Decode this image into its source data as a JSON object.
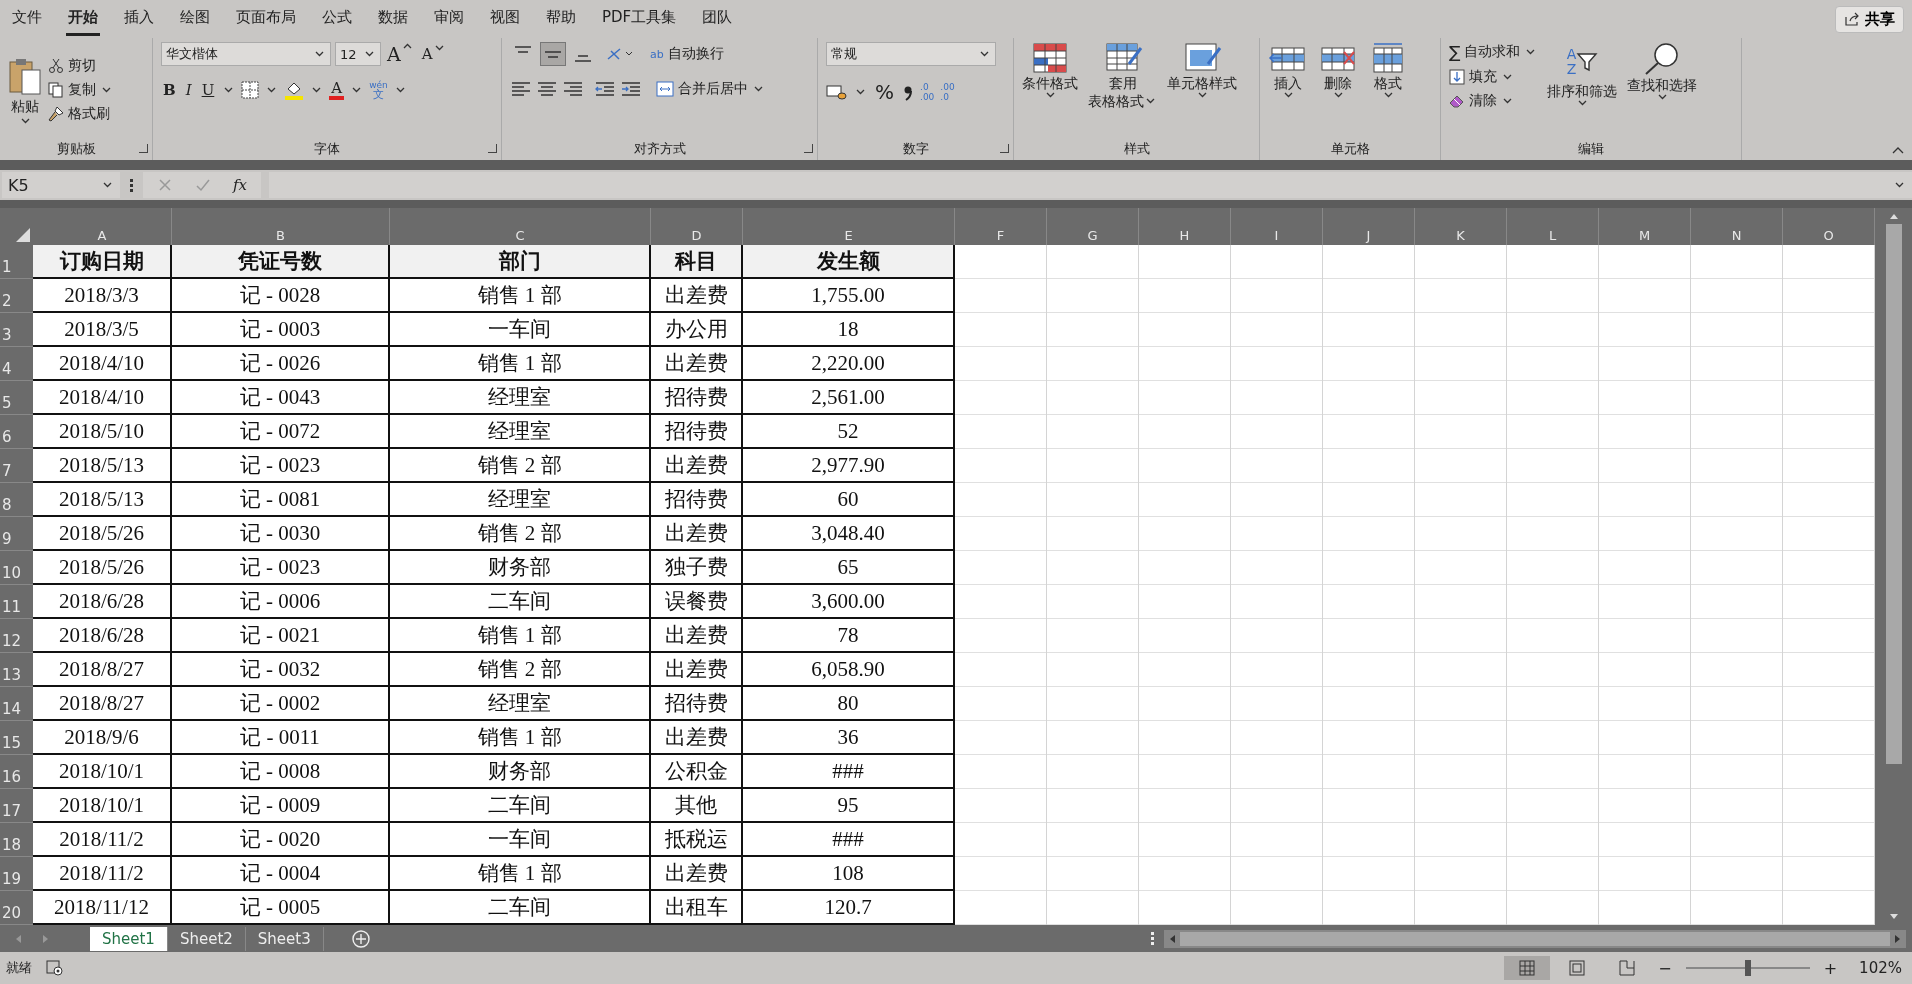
{
  "menu_tabs": [
    {
      "label": "文件",
      "selected": false
    },
    {
      "label": "开始",
      "selected": true
    },
    {
      "label": "插入",
      "selected": false
    },
    {
      "label": "绘图",
      "selected": false
    },
    {
      "label": "页面布局",
      "selected": false
    },
    {
      "label": "公式",
      "selected": false
    },
    {
      "label": "数据",
      "selected": false
    },
    {
      "label": "审阅",
      "selected": false
    },
    {
      "label": "视图",
      "selected": false
    },
    {
      "label": "帮助",
      "selected": false
    },
    {
      "label": "PDF工具集",
      "selected": false
    },
    {
      "label": "团队",
      "selected": false
    }
  ],
  "share_button": "共享",
  "clipboard": {
    "paste": "粘贴",
    "cut": "剪切",
    "copy": "复制",
    "format_painter": "格式刷",
    "label": "剪贴板"
  },
  "font": {
    "font_name": "华文楷体",
    "font_size": "12",
    "grow": "A",
    "shrink": "A",
    "bold": "B",
    "italic": "I",
    "underline": "U",
    "font_color": "A",
    "phonetic_top": "wén",
    "phonetic_bottom": "文",
    "label": "字体"
  },
  "alignment": {
    "vertical": [
      {
        "kind": "top",
        "selected": false
      },
      {
        "kind": "middle",
        "selected": true
      },
      {
        "kind": "bottom",
        "selected": false
      }
    ],
    "wrap_icon": "ab",
    "wrap_text": "自动换行",
    "merge_center": "合并后居中",
    "label": "对齐方式"
  },
  "number": {
    "format": "常规",
    "percent": "%",
    "decimals": [
      {
        "top": ".0",
        "bottom": ".00"
      },
      {
        "top": ".00",
        "bottom": ".0"
      }
    ],
    "label": "数字"
  },
  "styles": {
    "buttons": [
      {
        "kind": "conditional",
        "label": "条件格式"
      },
      {
        "kind": "table",
        "label": "套用",
        "label2": "表格格式"
      },
      {
        "kind": "cell",
        "label": "单元格样式"
      }
    ],
    "label": "样式"
  },
  "cells": {
    "buttons": [
      {
        "kind": "insert",
        "label": "插入"
      },
      {
        "kind": "delete",
        "label": "删除"
      },
      {
        "kind": "format",
        "label": "格式"
      }
    ],
    "label": "单元格"
  },
  "editing": {
    "autosum_icon": "∑",
    "autosum": "自动求和",
    "fill": "填充",
    "clear": "清除",
    "sort_letters": [
      "A",
      "Z"
    ],
    "sort_filter": "排序和筛选",
    "find_select": "查找和选择",
    "label": "编辑"
  },
  "formula_bar": {
    "name_box": "K5",
    "fx": "fx"
  },
  "sheet": {
    "columns": [
      "A",
      "B",
      "C",
      "D",
      "E",
      "F",
      "G",
      "H",
      "I",
      "J",
      "K",
      "L",
      "M",
      "N",
      "O"
    ],
    "row_headers": [
      "1",
      "2",
      "3",
      "4",
      "5",
      "6",
      "7",
      "8",
      "9",
      "10",
      "11",
      "12",
      "13",
      "14",
      "15",
      "16",
      "17",
      "18",
      "19",
      "20"
    ],
    "header": [
      "订购日期",
      "凭证号数",
      "部门",
      "科目",
      "发生额"
    ],
    "rows": [
      [
        "2018/3/3",
        "记 - 0028",
        "销售 1 部",
        "出差费",
        "1,755.00"
      ],
      [
        "2018/3/5",
        "记 - 0003",
        "一车间",
        "办公用",
        "18"
      ],
      [
        "2018/4/10",
        "记 - 0026",
        "销售 1 部",
        "出差费",
        "2,220.00"
      ],
      [
        "2018/4/10",
        "记 - 0043",
        "经理室",
        "招待费",
        "2,561.00"
      ],
      [
        "2018/5/10",
        "记 - 0072",
        "经理室",
        "招待费",
        "52"
      ],
      [
        "2018/5/13",
        "记 - 0023",
        "销售 2 部",
        "出差费",
        "2,977.90"
      ],
      [
        "2018/5/13",
        "记 - 0081",
        "经理室",
        "招待费",
        "60"
      ],
      [
        "2018/5/26",
        "记 - 0030",
        "销售 2 部",
        "出差费",
        "3,048.40"
      ],
      [
        "2018/5/26",
        "记 - 0023",
        "财务部",
        "独子费",
        "65"
      ],
      [
        "2018/6/28",
        "记 - 0006",
        "二车间",
        "误餐费",
        "3,600.00"
      ],
      [
        "2018/6/28",
        "记 - 0021",
        "销售 1 部",
        "出差费",
        "78"
      ],
      [
        "2018/8/27",
        "记 - 0032",
        "销售 2 部",
        "出差费",
        "6,058.90"
      ],
      [
        "2018/8/27",
        "记 - 0002",
        "经理室",
        "招待费",
        "80"
      ],
      [
        "2018/9/6",
        "记 - 0011",
        "销售 1 部",
        "出差费",
        "36"
      ],
      [
        "2018/10/1",
        "记 - 0008",
        "财务部",
        "公积金",
        "###"
      ],
      [
        "2018/10/1",
        "记 - 0009",
        "二车间",
        "其他",
        "95"
      ],
      [
        "2018/11/2",
        "记 - 0020",
        "一车间",
        "抵税运",
        "###"
      ],
      [
        "2018/11/2",
        "记 - 0004",
        "销售 1 部",
        "出差费",
        "108"
      ],
      [
        "2018/11/12",
        "记 - 0005",
        "二车间",
        "出租车",
        "120.7"
      ]
    ]
  },
  "sheet_tabs": [
    {
      "label": "Sheet1",
      "selected": true
    },
    {
      "label": "Sheet2",
      "selected": false
    },
    {
      "label": "Sheet3",
      "selected": false
    }
  ],
  "status_bar": {
    "status": "就绪",
    "views": [
      {
        "kind": "normal",
        "selected": true
      },
      {
        "kind": "page_layout",
        "selected": false
      },
      {
        "kind": "page_break",
        "selected": false
      }
    ],
    "zoom_minus": "−",
    "zoom_plus": "+",
    "zoom": {
      "level": 0.5
    },
    "zoom_percent": "102%"
  }
}
